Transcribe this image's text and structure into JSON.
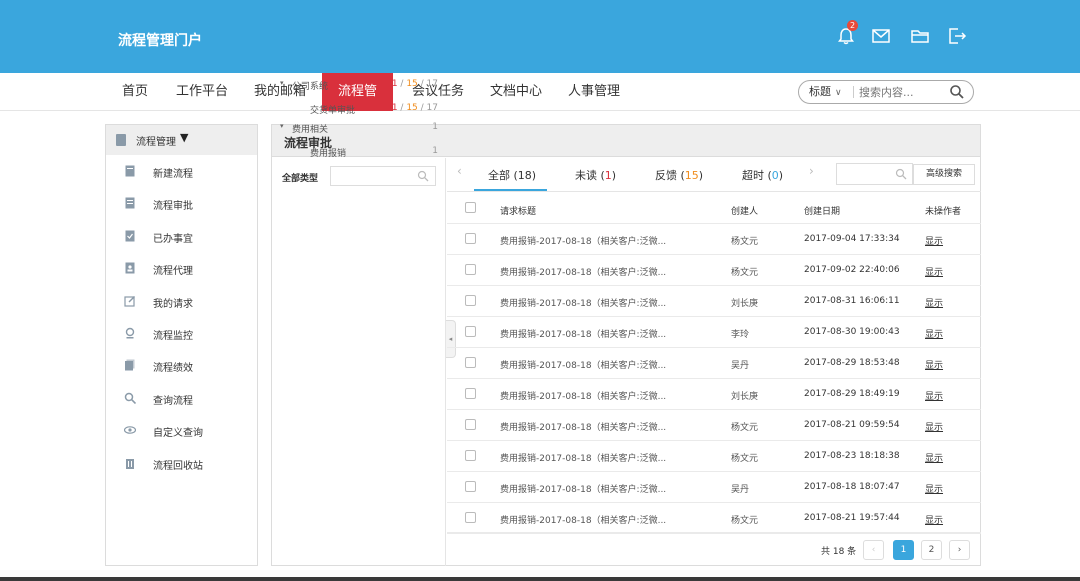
{
  "app": {
    "title": "流程管理门户"
  },
  "header": {
    "notification_count": "2"
  },
  "nav": {
    "items": [
      "首页",
      "工作平台",
      "我的邮箱",
      "流程管理",
      "会议任务",
      "文档中心",
      "人事管理"
    ],
    "active_index": 3
  },
  "search": {
    "select_value": "标题",
    "placeholder": "搜索内容..."
  },
  "sidebar": {
    "header": "流程管理",
    "items": [
      {
        "label": "新建流程",
        "icon": "new-process-icon"
      },
      {
        "label": "流程审批",
        "icon": "approval-icon"
      },
      {
        "label": "已办事宜",
        "icon": "done-icon"
      },
      {
        "label": "流程代理",
        "icon": "agent-icon"
      },
      {
        "label": "我的请求",
        "icon": "edit-icon"
      },
      {
        "label": "流程监控",
        "icon": "monitor-icon"
      },
      {
        "label": "流程绩效",
        "icon": "performance-icon"
      },
      {
        "label": "查询流程",
        "icon": "search-icon"
      },
      {
        "label": "自定义查询",
        "icon": "eye-icon"
      },
      {
        "label": "流程回收站",
        "icon": "trash-icon"
      }
    ]
  },
  "main": {
    "title": "流程审批"
  },
  "tree": {
    "label": "全部类型",
    "nodes": [
      {
        "label": "公司系统",
        "level": 0,
        "expanded": true,
        "count": {
          "a": "1",
          "b": "15",
          "c": "17"
        }
      },
      {
        "label": "交货单审批",
        "level": 1,
        "count": {
          "a": "1",
          "b": "15",
          "c": "17"
        }
      },
      {
        "label": "费用相关",
        "level": 0,
        "expanded": true,
        "count_single": "1"
      },
      {
        "label": "费用报销",
        "level": 1,
        "count_single": "1"
      }
    ]
  },
  "tabs": [
    {
      "label": "全部",
      "count": "18",
      "active": true
    },
    {
      "label": "未读",
      "count": "1"
    },
    {
      "label": "反馈",
      "count": "15"
    },
    {
      "label": "超时",
      "count": "0"
    }
  ],
  "advanced_search_label": "高级搜索",
  "table": {
    "headers": {
      "title": "请求标题",
      "creator": "创建人",
      "date": "创建日期",
      "op": "未操作者"
    },
    "rows": [
      {
        "title": "费用报销-2017-08-18（相关客户:泛微...",
        "creator": "杨文元",
        "date": "2017-09-04 17:33:34",
        "op": "显示"
      },
      {
        "title": "费用报销-2017-08-18（相关客户:泛微...",
        "creator": "杨文元",
        "date": "2017-09-02 22:40:06",
        "op": "显示"
      },
      {
        "title": "费用报销-2017-08-18（相关客户:泛微...",
        "creator": "刘长庚",
        "date": "2017-08-31 16:06:11",
        "op": "显示"
      },
      {
        "title": "费用报销-2017-08-18（相关客户:泛微...",
        "creator": "李玲",
        "date": "2017-08-30 19:00:43",
        "op": "显示"
      },
      {
        "title": "费用报销-2017-08-18（相关客户:泛微...",
        "creator": "吴丹",
        "date": "2017-08-29 18:53:48",
        "op": "显示"
      },
      {
        "title": "费用报销-2017-08-18（相关客户:泛微...",
        "creator": "刘长庚",
        "date": "2017-08-29 18:49:19",
        "op": "显示"
      },
      {
        "title": "费用报销-2017-08-18（相关客户:泛微...",
        "creator": "杨文元",
        "date": "2017-08-21 09:59:54",
        "op": "显示"
      },
      {
        "title": "费用报销-2017-08-18（相关客户:泛微...",
        "creator": "杨文元",
        "date": "2017-08-23 18:18:38",
        "op": "显示"
      },
      {
        "title": "费用报销-2017-08-18（相关客户:泛微...",
        "creator": "吴丹",
        "date": "2017-08-18 18:07:47",
        "op": "显示"
      },
      {
        "title": "费用报销-2017-08-18（相关客户:泛微...",
        "creator": "杨文元",
        "date": "2017-08-21 19:57:44",
        "op": "显示"
      }
    ]
  },
  "pager": {
    "total": "共 18 条",
    "pages": [
      "1",
      "2"
    ],
    "current": "1",
    "prev": "‹",
    "next": "›"
  },
  "colors": {
    "header_bg": "#3aa6dd",
    "active_nav": "#d9303c",
    "accent": "#3aa6dd"
  }
}
